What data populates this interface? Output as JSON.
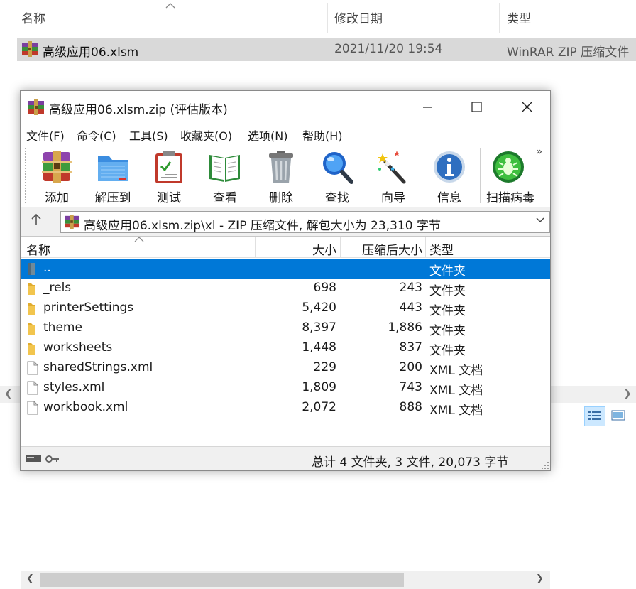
{
  "explorer": {
    "columns": {
      "name": "名称",
      "date": "修改日期",
      "type": "类型"
    },
    "row": {
      "name": "高级应用06.xlsm",
      "date": "2021/11/20 19:54",
      "type": "WinRAR ZIP 压缩文件"
    }
  },
  "window": {
    "title": "高级应用06.xlsm.zip (评估版本)",
    "menu": [
      "文件(F)",
      "命令(C)",
      "工具(S)",
      "收藏夹(O)",
      "选项(N)",
      "帮助(H)"
    ],
    "toolbar": [
      "添加",
      "解压到",
      "测试",
      "查看",
      "删除",
      "查找",
      "向导",
      "信息",
      "扫描病毒"
    ],
    "address": "高级应用06.xlsm.zip\\xl - ZIP 压缩文件, 解包大小为 23,310 字节",
    "columns": {
      "name": "名称",
      "size": "大小",
      "packed": "压缩后大小",
      "type": "类型"
    },
    "rows": [
      {
        "name": "..",
        "size": "",
        "packed": "",
        "type": "文件夹",
        "icon": "parent-folder-icon",
        "selected": true
      },
      {
        "name": "_rels",
        "size": "698",
        "packed": "243",
        "type": "文件夹",
        "icon": "folder-icon"
      },
      {
        "name": "printerSettings",
        "size": "5,420",
        "packed": "443",
        "type": "文件夹",
        "icon": "folder-icon"
      },
      {
        "name": "theme",
        "size": "8,397",
        "packed": "1,886",
        "type": "文件夹",
        "icon": "folder-icon"
      },
      {
        "name": "worksheets",
        "size": "1,448",
        "packed": "837",
        "type": "文件夹",
        "icon": "folder-icon"
      },
      {
        "name": "sharedStrings.xml",
        "size": "229",
        "packed": "200",
        "type": "XML 文档",
        "icon": "file-icon"
      },
      {
        "name": "styles.xml",
        "size": "1,809",
        "packed": "743",
        "type": "XML 文档",
        "icon": "file-icon"
      },
      {
        "name": "workbook.xml",
        "size": "2,072",
        "packed": "888",
        "type": "XML 文档",
        "icon": "file-icon"
      }
    ],
    "status": "总计 4 文件夹, 3 文件, 20,073 字节"
  },
  "colors": {
    "selection": "#0078d7",
    "explorer_selection": "#d9d9d9",
    "folder": "#f2c54e"
  }
}
